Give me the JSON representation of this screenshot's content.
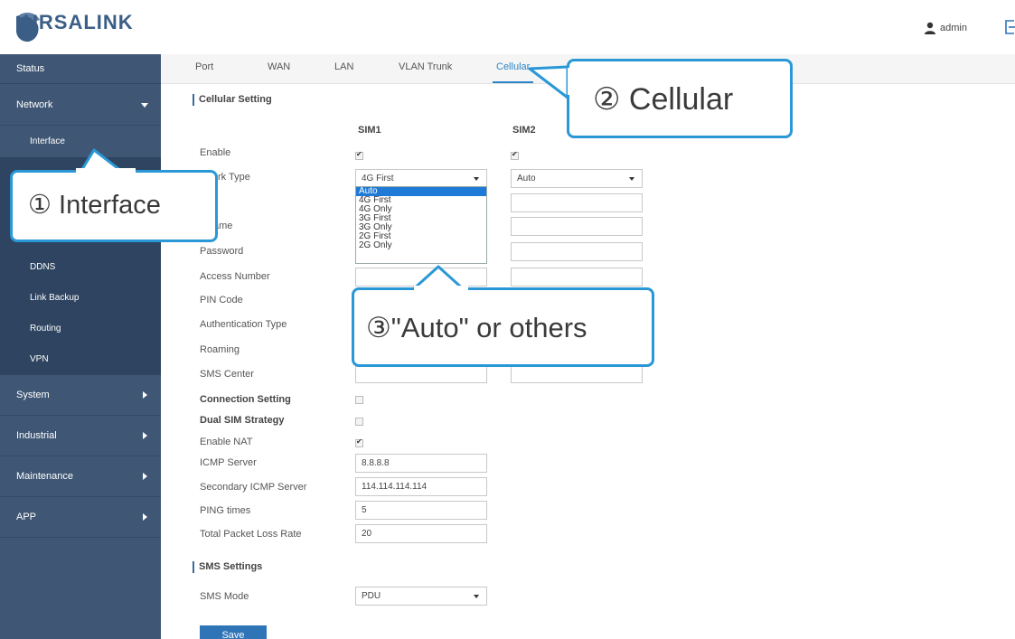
{
  "header": {
    "brand": "URSALINK",
    "user": "admin"
  },
  "sidebar": {
    "status": "Status",
    "network": "Network",
    "network_items": [
      "Interface",
      "DDNS",
      "Link Backup",
      "Routing",
      "VPN"
    ],
    "system": "System",
    "industrial": "Industrial",
    "maintenance": "Maintenance",
    "app": "APP"
  },
  "tabs": [
    "Port",
    "WAN",
    "LAN",
    "VLAN Trunk",
    "Cellular"
  ],
  "cellular": {
    "title": "Cellular Setting",
    "col_sim1": "SIM1",
    "col_sim2": "SIM2",
    "labels": {
      "enable": "Enable",
      "network_type": "rk Type",
      "apn_name": "ame",
      "password": "Password",
      "access_number": "Access Number",
      "pin_code": "PIN Code",
      "auth_type": "Authentication Type",
      "roaming": "Roaming",
      "sms_center": "SMS Center",
      "connection_setting": "Connection Setting",
      "dual_sim_strategy": "Dual SIM Strategy",
      "enable_nat": "Enable NAT",
      "icmp_server": "ICMP Server",
      "secondary_icmp": "Secondary ICMP Server",
      "ping_times": "PING times",
      "packet_loss": "Total Packet Loss Rate"
    },
    "sim1_network_type": "4G First",
    "sim2_network_type": "Auto",
    "network_type_options": [
      "Auto",
      "4G First",
      "4G Only",
      "3G First",
      "3G Only",
      "2G First",
      "2G Only"
    ],
    "icmp_server": "8.8.8.8",
    "secondary_icmp_server": "114.114.114.114",
    "ping_times": "5",
    "packet_loss_rate": "20"
  },
  "sms": {
    "title": "SMS Settings",
    "mode_label": "SMS Mode",
    "mode_value": "PDU"
  },
  "save_label": "Save",
  "callouts": {
    "interface": "① Interface",
    "cellular": "② Cellular",
    "auto": "③\"Auto\" or others"
  },
  "colors": {
    "sidebar": "#3f5775",
    "accent": "#2b86c5",
    "callout_border": "#2a98d6",
    "selected_option": "#1e7ad6"
  }
}
